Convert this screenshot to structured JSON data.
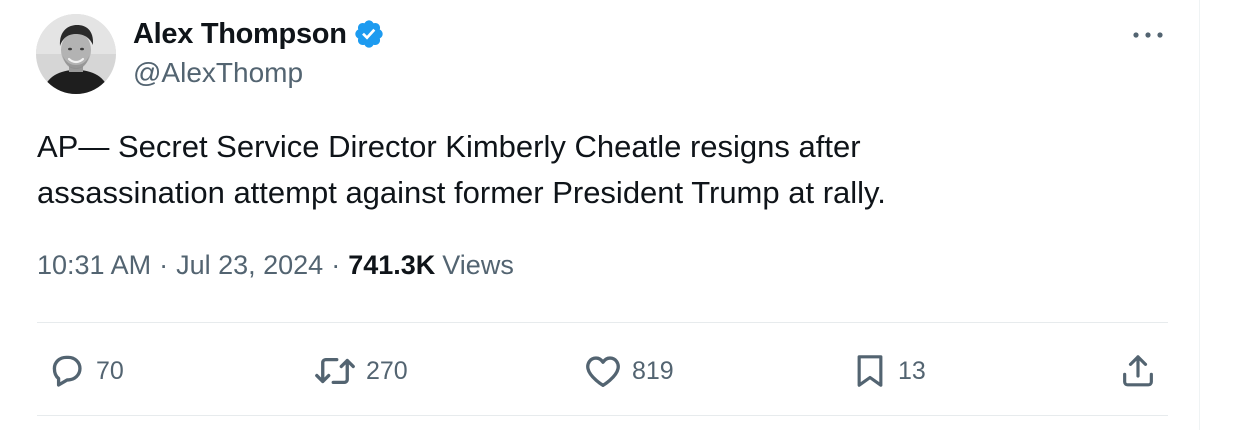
{
  "author": {
    "name": "Alex Thompson",
    "handle": "@AlexThomp",
    "verified": true,
    "verified_color": "#1d9bf0"
  },
  "tweet": {
    "text": "AP— Secret Service Director Kimberly Cheatle resigns after\nassassination attempt against former President Trump at rally.",
    "time": "10:31 AM",
    "separator": "·",
    "date": "Jul 23, 2024",
    "views_count": "741.3K",
    "views_label": "Views"
  },
  "actions": {
    "replies": "70",
    "reposts": "270",
    "likes": "819",
    "bookmarks": "13"
  },
  "icons": {
    "more": "more-horizontal-icon",
    "reply": "speech-bubble-icon",
    "repost": "repost-arrows-icon",
    "like": "heart-icon",
    "bookmark": "bookmark-icon",
    "share": "share-upload-icon"
  },
  "colors": {
    "text_primary": "#0f1419",
    "text_secondary": "#536471",
    "accent": "#1d9bf0",
    "divider": "#e7ebed"
  }
}
